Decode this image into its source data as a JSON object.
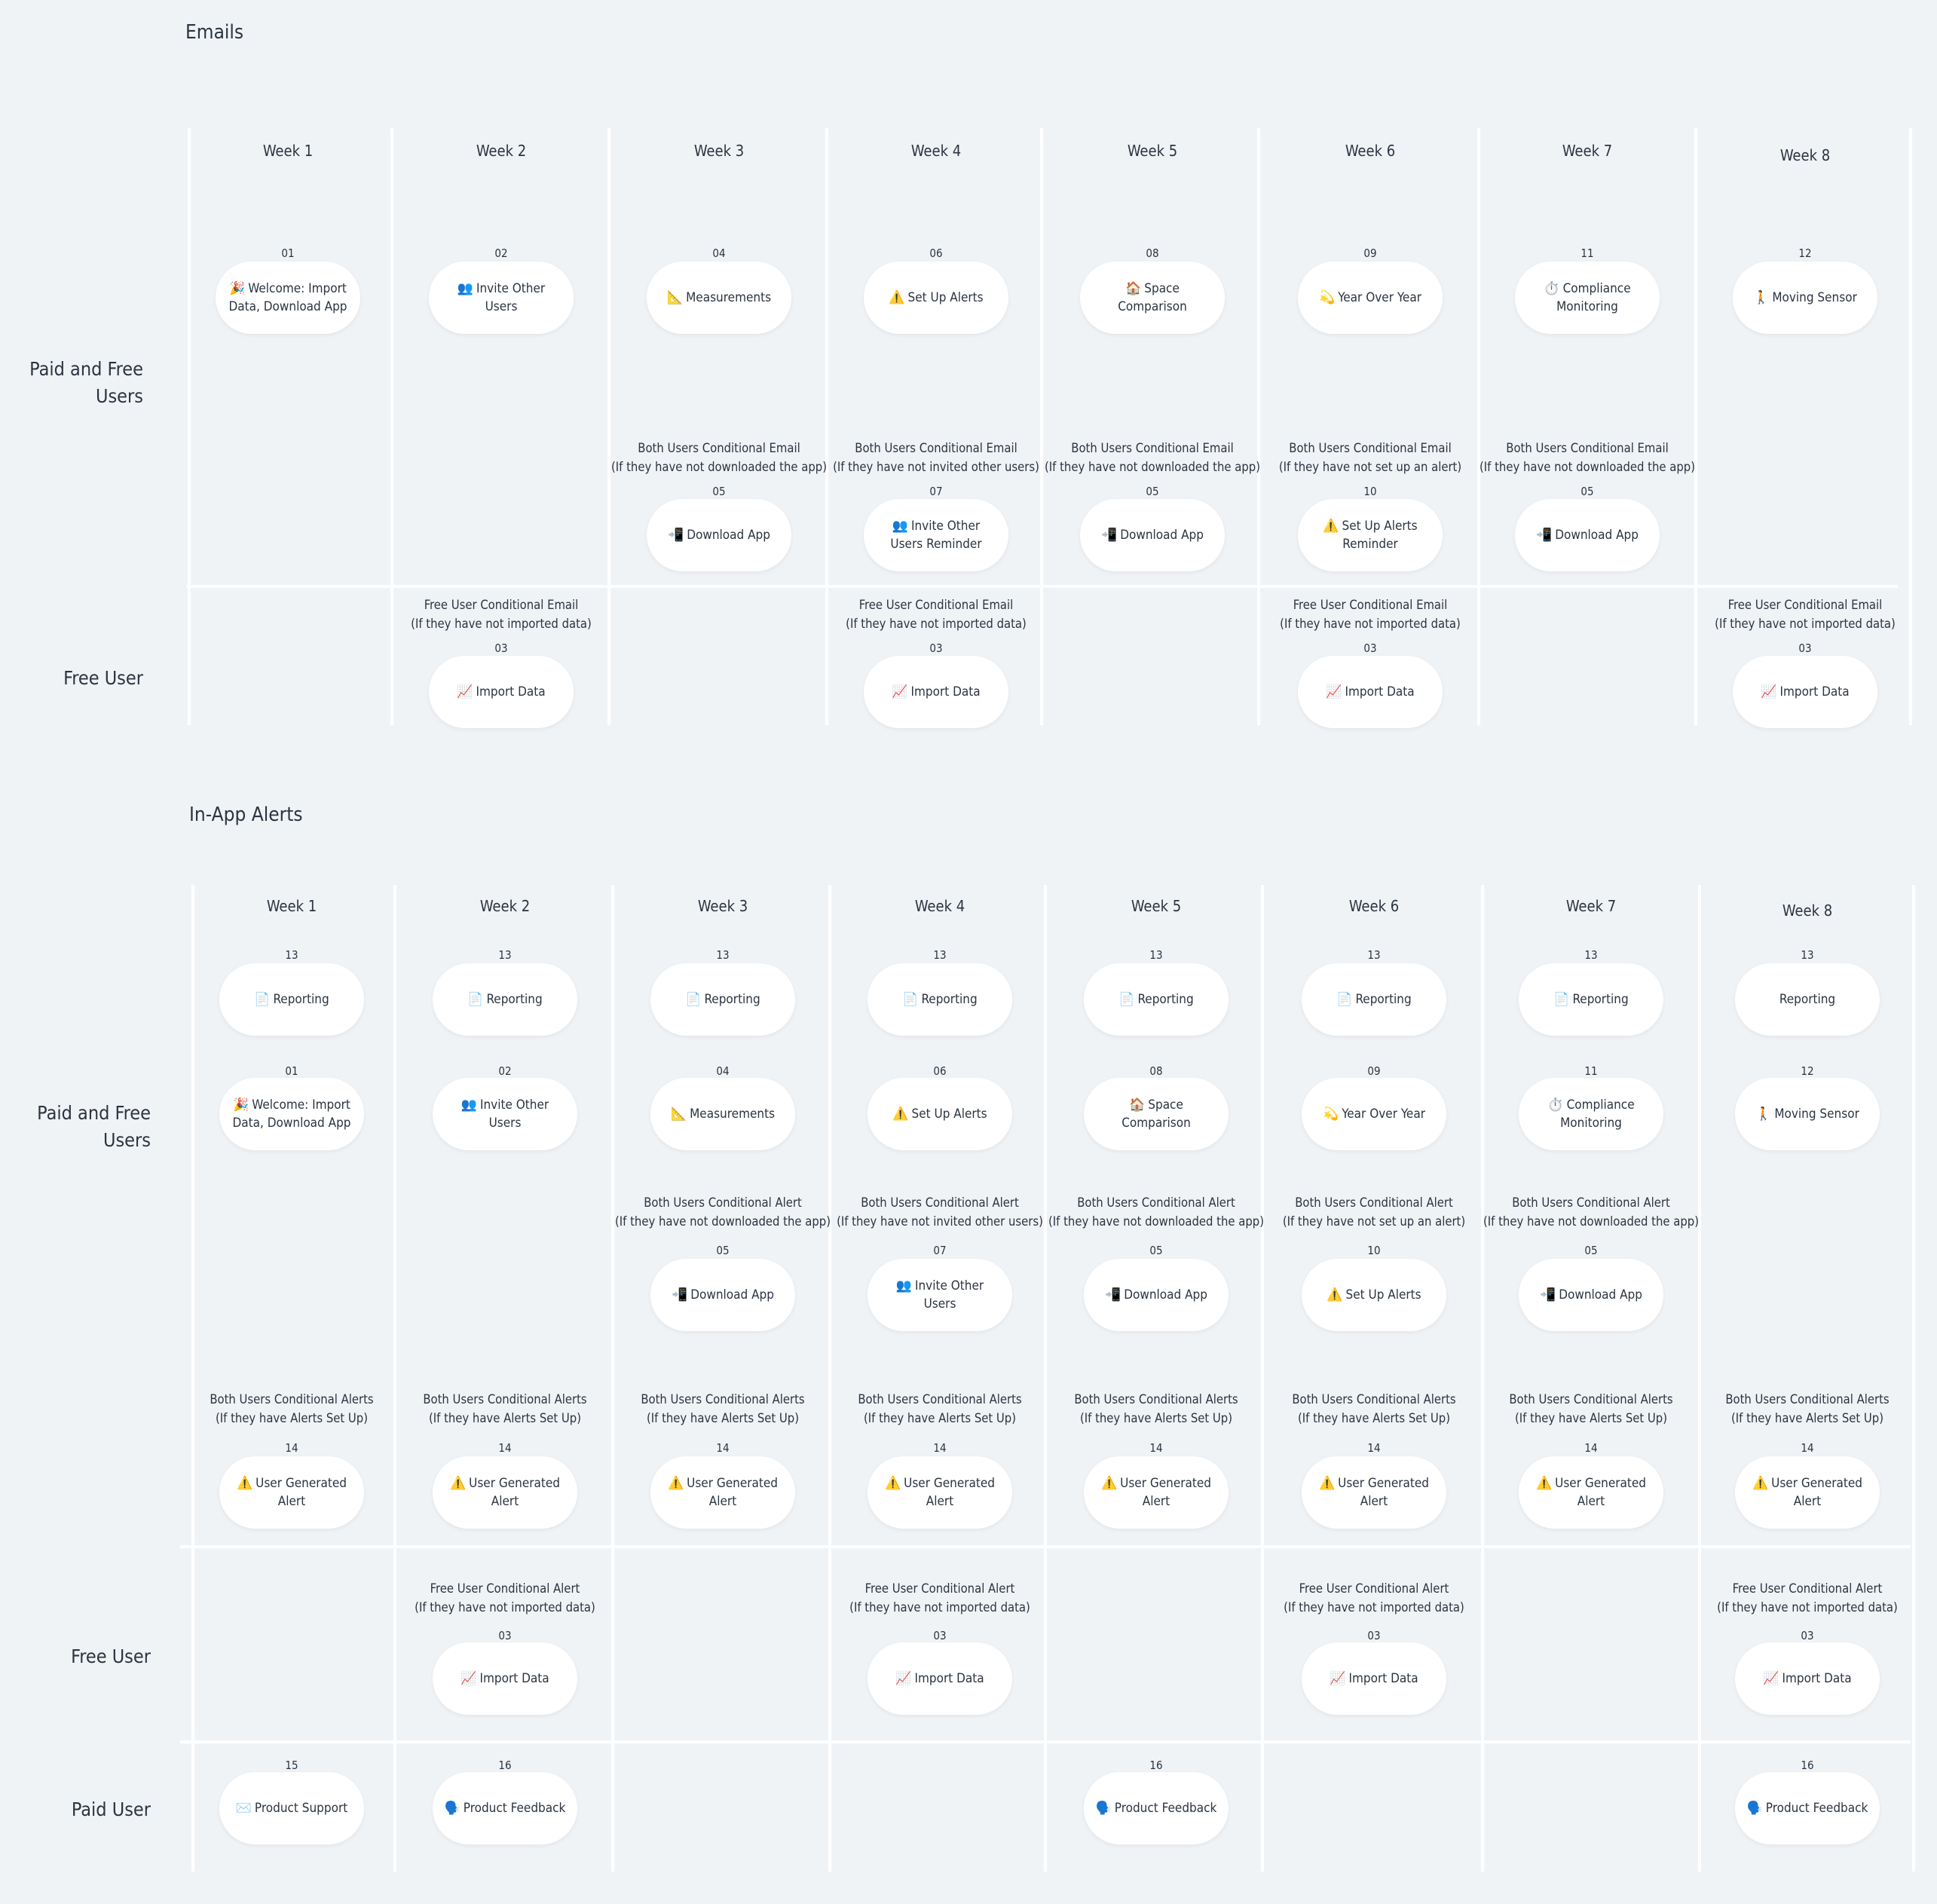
{
  "sections": [
    {
      "id": "emails",
      "title": "Emails",
      "weeks": [
        "Week 1",
        "Week 2",
        "Week 3",
        "Week 4",
        "Week 5",
        "Week 6",
        "Week 7",
        "Week 8"
      ],
      "lanes": [
        {
          "key": "paid_free",
          "label": "Paid and Free Users"
        },
        {
          "key": "free",
          "label": "Free User"
        }
      ],
      "items": [
        {
          "week": 1,
          "row": "primary",
          "number": "01",
          "icon": "🎉",
          "label": "Welcome: Import Data, Download App"
        },
        {
          "week": 2,
          "row": "primary",
          "number": "02",
          "icon": "👥",
          "label": "Invite Other Users"
        },
        {
          "week": 3,
          "row": "primary",
          "number": "04",
          "icon": "📐",
          "label": "Measurements"
        },
        {
          "week": 4,
          "row": "primary",
          "number": "06",
          "icon": "⚠️",
          "label": "Set Up Alerts"
        },
        {
          "week": 5,
          "row": "primary",
          "number": "08",
          "icon": "🏠",
          "label": "Space Comparison"
        },
        {
          "week": 6,
          "row": "primary",
          "number": "09",
          "icon": "💫",
          "label": "Year Over Year"
        },
        {
          "week": 7,
          "row": "primary",
          "number": "11",
          "icon": "⏱️",
          "label": "Compliance Monitoring"
        },
        {
          "week": 8,
          "row": "primary",
          "number": "12",
          "icon": "🚶",
          "label": "Moving Sensor"
        },
        {
          "week": 3,
          "row": "conditional",
          "number": "05",
          "icon": "📲",
          "label": "Download App",
          "condition": [
            "Both Users Conditional Email",
            "(If they have not downloaded the app)"
          ]
        },
        {
          "week": 4,
          "row": "conditional",
          "number": "07",
          "icon": "👥",
          "label": "Invite Other Users Reminder",
          "condition": [
            "Both Users Conditional Email",
            "(If they have not invited other users)"
          ]
        },
        {
          "week": 5,
          "row": "conditional",
          "number": "05",
          "icon": "📲",
          "label": "Download App",
          "condition": [
            "Both Users Conditional Email",
            "(If they have not downloaded the app)"
          ]
        },
        {
          "week": 6,
          "row": "conditional",
          "number": "10",
          "icon": "⚠️",
          "label": "Set Up Alerts Reminder",
          "condition": [
            "Both Users Conditional Email",
            "(If they have not set up an alert)"
          ]
        },
        {
          "week": 7,
          "row": "conditional",
          "number": "05",
          "icon": "📲",
          "label": "Download App",
          "condition": [
            "Both Users Conditional Email",
            "(If they have not downloaded the app)"
          ]
        },
        {
          "week": 2,
          "row": "free",
          "number": "03",
          "icon": "📈",
          "label": "Import Data",
          "condition": [
            "Free User Conditional Email",
            "(If they have not imported data)"
          ]
        },
        {
          "week": 4,
          "row": "free",
          "number": "03",
          "icon": "📈",
          "label": "Import Data",
          "condition": [
            "Free User Conditional Email",
            "(If they have not imported data)"
          ]
        },
        {
          "week": 6,
          "row": "free",
          "number": "03",
          "icon": "📈",
          "label": "Import Data",
          "condition": [
            "Free User Conditional Email",
            "(If they have not imported data)"
          ]
        },
        {
          "week": 8,
          "row": "free",
          "number": "03",
          "icon": "📈",
          "label": "Import Data",
          "condition": [
            "Free User Conditional Email",
            "(If they have not imported data)"
          ]
        }
      ]
    },
    {
      "id": "in_app_alerts",
      "title": "In-App Alerts",
      "weeks": [
        "Week 1",
        "Week 2",
        "Week 3",
        "Week 4",
        "Week 5",
        "Week 6",
        "Week 7",
        "Week 8"
      ],
      "lanes": [
        {
          "key": "paid_free",
          "label": "Paid and Free Users"
        },
        {
          "key": "free",
          "label": "Free User"
        },
        {
          "key": "paid",
          "label": "Paid User"
        }
      ],
      "items": [
        {
          "week": 1,
          "row": "reporting",
          "number": "13",
          "icon": "📄",
          "label": "Reporting"
        },
        {
          "week": 2,
          "row": "reporting",
          "number": "13",
          "icon": "📄",
          "label": "Reporting"
        },
        {
          "week": 3,
          "row": "reporting",
          "number": "13",
          "icon": "📄",
          "label": "Reporting"
        },
        {
          "week": 4,
          "row": "reporting",
          "number": "13",
          "icon": "📄",
          "label": "Reporting"
        },
        {
          "week": 5,
          "row": "reporting",
          "number": "13",
          "icon": "📄",
          "label": "Reporting"
        },
        {
          "week": 6,
          "row": "reporting",
          "number": "13",
          "icon": "📄",
          "label": "Reporting"
        },
        {
          "week": 7,
          "row": "reporting",
          "number": "13",
          "icon": "📄",
          "label": "Reporting"
        },
        {
          "week": 8,
          "row": "reporting",
          "number": "13",
          "icon": "",
          "label": "Reporting"
        },
        {
          "week": 1,
          "row": "primary",
          "number": "01",
          "icon": "🎉",
          "label": "Welcome: Import Data, Download App"
        },
        {
          "week": 2,
          "row": "primary",
          "number": "02",
          "icon": "👥",
          "label": "Invite Other Users"
        },
        {
          "week": 3,
          "row": "primary",
          "number": "04",
          "icon": "📐",
          "label": "Measurements"
        },
        {
          "week": 4,
          "row": "primary",
          "number": "06",
          "icon": "⚠️",
          "label": "Set Up Alerts"
        },
        {
          "week": 5,
          "row": "primary",
          "number": "08",
          "icon": "🏠",
          "label": "Space Comparison"
        },
        {
          "week": 6,
          "row": "primary",
          "number": "09",
          "icon": "💫",
          "label": "Year Over Year"
        },
        {
          "week": 7,
          "row": "primary",
          "number": "11",
          "icon": "⏱️",
          "label": "Compliance Monitoring"
        },
        {
          "week": 8,
          "row": "primary",
          "number": "12",
          "icon": "🚶",
          "label": "Moving Sensor"
        },
        {
          "week": 3,
          "row": "conditional",
          "number": "05",
          "icon": "📲",
          "label": "Download App",
          "condition": [
            "Both Users Conditional Alert",
            "(If they have not downloaded the app)"
          ]
        },
        {
          "week": 4,
          "row": "conditional",
          "number": "07",
          "icon": "👥",
          "label": "Invite Other Users",
          "condition": [
            "Both Users Conditional Alert",
            "(If they have not invited other users)"
          ]
        },
        {
          "week": 5,
          "row": "conditional",
          "number": "05",
          "icon": "📲",
          "label": "Download App",
          "condition": [
            "Both Users Conditional Alert",
            "(If they have not downloaded the app)"
          ]
        },
        {
          "week": 6,
          "row": "conditional",
          "number": "10",
          "icon": "⚠️",
          "label": "Set Up Alerts",
          "condition": [
            "Both Users Conditional Alert",
            "(If they have not set up an alert)"
          ]
        },
        {
          "week": 7,
          "row": "conditional",
          "number": "05",
          "icon": "📲",
          "label": "Download App",
          "condition": [
            "Both Users Conditional Alert",
            "(If they have not downloaded the app)"
          ]
        },
        {
          "week": 1,
          "row": "user_alerts",
          "number": "14",
          "icon": "⚠️",
          "label": "User Generated Alert",
          "condition": [
            "Both Users Conditional Alerts",
            "(If they have Alerts Set Up)"
          ]
        },
        {
          "week": 2,
          "row": "user_alerts",
          "number": "14",
          "icon": "⚠️",
          "label": "User Generated Alert",
          "condition": [
            "Both Users Conditional Alerts",
            "(If they have Alerts Set Up)"
          ]
        },
        {
          "week": 3,
          "row": "user_alerts",
          "number": "14",
          "icon": "⚠️",
          "label": "User Generated Alert",
          "condition": [
            "Both Users Conditional Alerts",
            "(If they have Alerts Set Up)"
          ]
        },
        {
          "week": 4,
          "row": "user_alerts",
          "number": "14",
          "icon": "⚠️",
          "label": "User Generated Alert",
          "condition": [
            "Both Users Conditional Alerts",
            "(If they have Alerts Set Up)"
          ]
        },
        {
          "week": 5,
          "row": "user_alerts",
          "number": "14",
          "icon": "⚠️",
          "label": "User Generated Alert",
          "condition": [
            "Both Users Conditional Alerts",
            "(If they have Alerts Set Up)"
          ]
        },
        {
          "week": 6,
          "row": "user_alerts",
          "number": "14",
          "icon": "⚠️",
          "label": "User Generated Alert",
          "condition": [
            "Both Users Conditional Alerts",
            "(If they have Alerts Set Up)"
          ]
        },
        {
          "week": 7,
          "row": "user_alerts",
          "number": "14",
          "icon": "⚠️",
          "label": "User Generated Alert",
          "condition": [
            "Both Users Conditional Alerts",
            "(If they have Alerts Set Up)"
          ]
        },
        {
          "week": 8,
          "row": "user_alerts",
          "number": "14",
          "icon": "⚠️",
          "label": "User Generated Alert",
          "condition": [
            "Both Users Conditional Alerts",
            "(If they have Alerts Set Up)"
          ]
        },
        {
          "week": 2,
          "row": "free",
          "number": "03",
          "icon": "📈",
          "label": "Import Data",
          "condition": [
            "Free User Conditional Alert",
            "(If they have not imported data)"
          ]
        },
        {
          "week": 4,
          "row": "free",
          "number": "03",
          "icon": "📈",
          "label": "Import Data",
          "condition": [
            "Free User Conditional Alert",
            "(If they have not imported data)"
          ]
        },
        {
          "week": 6,
          "row": "free",
          "number": "03",
          "icon": "📈",
          "label": "Import Data",
          "condition": [
            "Free User Conditional Alert",
            "(If they have not imported data)"
          ]
        },
        {
          "week": 8,
          "row": "free",
          "number": "03",
          "icon": "📈",
          "label": "Import Data",
          "condition": [
            "Free User Conditional Alert",
            "(If they have not imported data)"
          ]
        },
        {
          "week": 1,
          "row": "paid",
          "number": "15",
          "icon": "✉️",
          "label": "Product Support"
        },
        {
          "week": 2,
          "row": "paid",
          "number": "16",
          "icon": "🗣️",
          "label": "Product Feedback"
        },
        {
          "week": 5,
          "row": "paid",
          "number": "16",
          "icon": "🗣️",
          "label": "Product Feedback"
        },
        {
          "week": 8,
          "row": "paid",
          "number": "16",
          "icon": "🗣️",
          "label": "Product Feedback"
        }
      ]
    }
  ]
}
